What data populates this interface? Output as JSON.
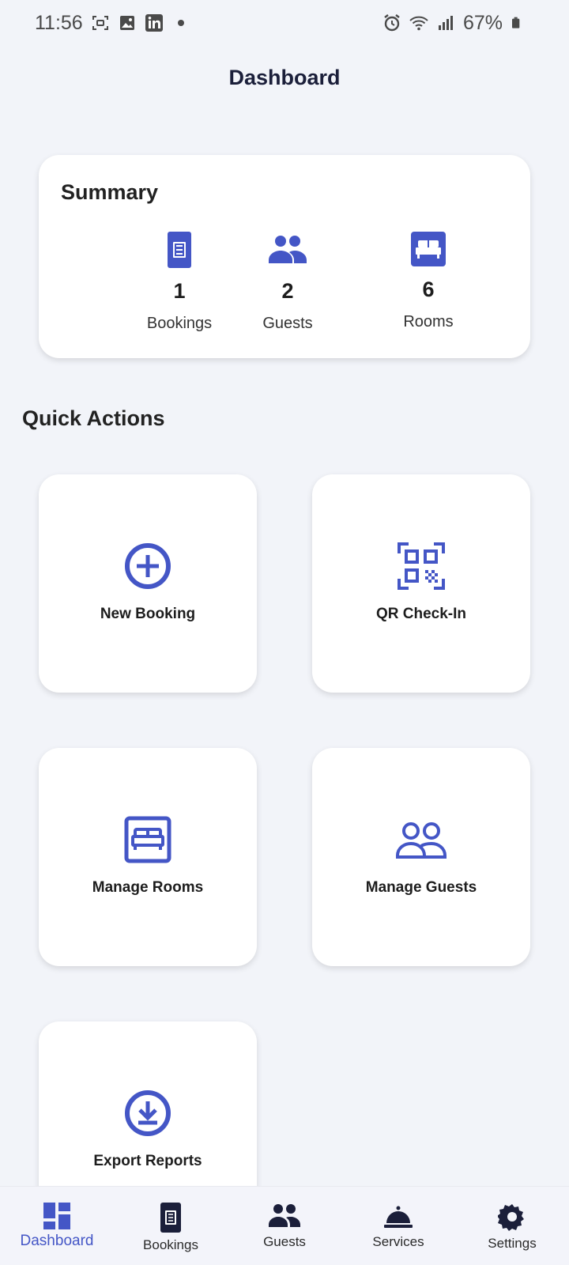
{
  "status_bar": {
    "time": "11:56",
    "battery": "67%",
    "icons_left": [
      "screen-record-icon",
      "image-icon",
      "linkedin-icon",
      "dot-icon"
    ],
    "icons_right": [
      "alarm-icon",
      "wifi-icon",
      "signal-icon",
      "battery-icon"
    ]
  },
  "header": {
    "title": "Dashboard"
  },
  "summary": {
    "title": "Summary",
    "stats": [
      {
        "value": "1",
        "label": "Bookings",
        "icon": "booking-icon"
      },
      {
        "value": "2",
        "label": "Guests",
        "icon": "guests-icon"
      },
      {
        "value": "6",
        "label": "Rooms",
        "icon": "bed-icon"
      }
    ]
  },
  "quick_actions": {
    "title": "Quick Actions",
    "items": [
      {
        "label": "New Booking",
        "icon": "add-circle-icon"
      },
      {
        "label": "QR Check-In",
        "icon": "qr-code-icon"
      },
      {
        "label": "Manage Rooms",
        "icon": "bed-outline-icon"
      },
      {
        "label": "Manage Guests",
        "icon": "people-outline-icon"
      },
      {
        "label": "Export Reports",
        "icon": "download-circle-icon"
      }
    ]
  },
  "bottom_nav": {
    "items": [
      {
        "label": "Dashboard",
        "icon": "dashboard-icon",
        "active": true
      },
      {
        "label": "Bookings",
        "icon": "booking-icon"
      },
      {
        "label": "Guests",
        "icon": "guests-icon"
      },
      {
        "label": "Services",
        "icon": "room-service-icon"
      },
      {
        "label": "Settings",
        "icon": "gear-icon"
      }
    ]
  },
  "colors": {
    "accent": "#4456c6",
    "background": "#f2f4f9",
    "card": "#ffffff",
    "nav_icon": "#1b1f3a"
  }
}
